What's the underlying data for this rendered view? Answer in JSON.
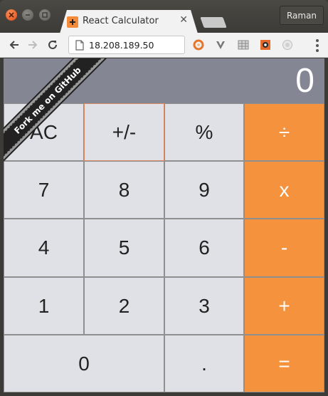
{
  "browser": {
    "tab": {
      "title": "React Calculator"
    },
    "profile_name": "Raman",
    "url": "18.208.189.50"
  },
  "calculator": {
    "display": "0",
    "ribbon": "Fork me on GitHub",
    "keys": {
      "ac": "AC",
      "sign": "+/-",
      "percent": "%",
      "divide": "÷",
      "seven": "7",
      "eight": "8",
      "nine": "9",
      "multiply": "x",
      "four": "4",
      "five": "5",
      "six": "6",
      "subtract": "-",
      "one": "1",
      "two": "2",
      "three": "3",
      "add": "+",
      "zero": "0",
      "decimal": ".",
      "equals": "="
    }
  },
  "colors": {
    "operator": "#f5923e",
    "key": "#e0e0e7",
    "display": "#858694",
    "ribbon": "#222222"
  }
}
